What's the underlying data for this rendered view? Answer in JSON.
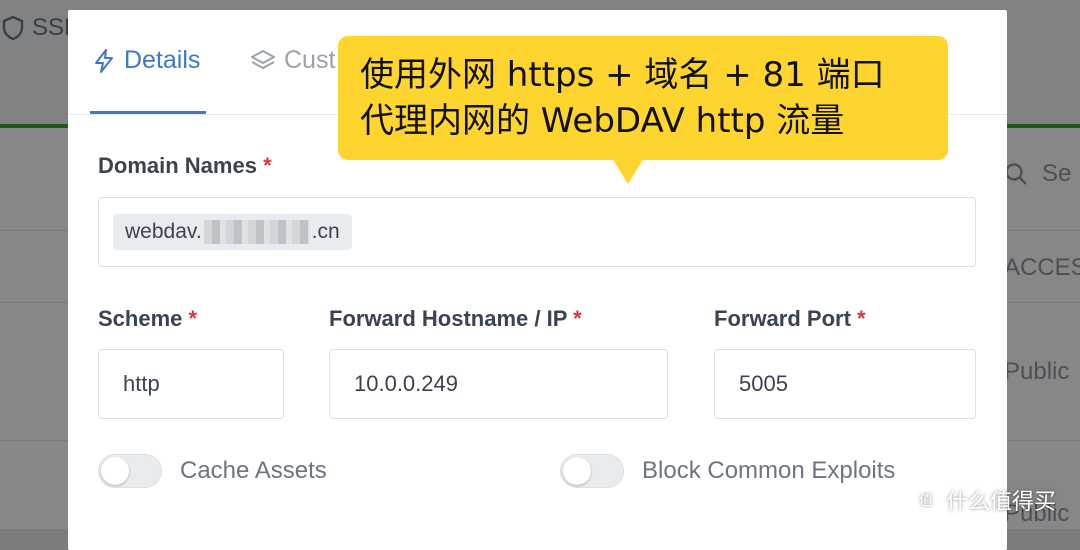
{
  "background": {
    "ssl_tab": "SSL",
    "search_placeholder": "Se",
    "column_header": "ACCESS",
    "rows": [
      "Public",
      "Public"
    ]
  },
  "modal": {
    "tabs": [
      {
        "label": "Details",
        "icon": "lightning-icon",
        "active": true
      },
      {
        "label": "Cust",
        "icon": "layers-icon",
        "active": false
      }
    ],
    "domain_names": {
      "label": "Domain Names",
      "required_mark": "*",
      "value_prefix": "webdav.",
      "value_suffix": ".cn"
    },
    "scheme": {
      "label": "Scheme",
      "required_mark": "*",
      "value": "http"
    },
    "forward_host": {
      "label": "Forward Hostname / IP",
      "required_mark": "*",
      "value": "10.0.0.249"
    },
    "forward_port": {
      "label": "Forward Port",
      "required_mark": "*",
      "value": "5005"
    },
    "toggles": [
      {
        "label": "Cache Assets",
        "on": false
      },
      {
        "label": "Block Common Exploits",
        "on": false
      }
    ]
  },
  "callout": {
    "line1": "使用外网 https + 域名 + 81 端口",
    "line2": "代理内网的 WebDAV http 流量"
  },
  "watermark": {
    "logo_text": "值",
    "text": "什么值得买"
  },
  "colors": {
    "accent": "#3f78c8",
    "required": "#d63939",
    "callout": "#fdd52e",
    "green_bar": "#3fa535"
  }
}
